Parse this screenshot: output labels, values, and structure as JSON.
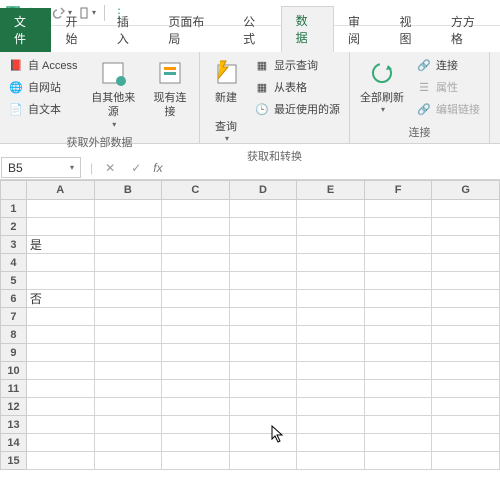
{
  "qat": {
    "save": "save",
    "undo": "undo",
    "redo": "redo",
    "custom": "custom"
  },
  "tabs": {
    "file": "文件",
    "home": "开始",
    "insert": "插入",
    "layout": "页面布局",
    "formulas": "公式",
    "data": "数据",
    "review": "审阅",
    "view": "视图",
    "square": "方方格"
  },
  "ribbon": {
    "ext": {
      "access": "自 Access",
      "web": "自网站",
      "text": "自文本",
      "other": "自其他来源",
      "existing": "现有连接",
      "label": "获取外部数据"
    },
    "gt": {
      "newquery": "新建",
      "newquery2": "查询",
      "show": "显示查询",
      "fromtable": "从表格",
      "recent": "最近使用的源",
      "label": "获取和转换"
    },
    "conn": {
      "refresh": "全部刷新",
      "conn": "连接",
      "prop": "属性",
      "edit": "编辑链接",
      "label": "连接"
    }
  },
  "namebox": "B5",
  "fx": "fx",
  "cols": [
    "A",
    "B",
    "C",
    "D",
    "E",
    "F",
    "G"
  ],
  "rows": [
    "1",
    "2",
    "3",
    "4",
    "5",
    "6",
    "7",
    "8",
    "9",
    "10",
    "11",
    "12",
    "13",
    "14",
    "15"
  ],
  "cells": {
    "A3": "是",
    "A6": "否"
  }
}
